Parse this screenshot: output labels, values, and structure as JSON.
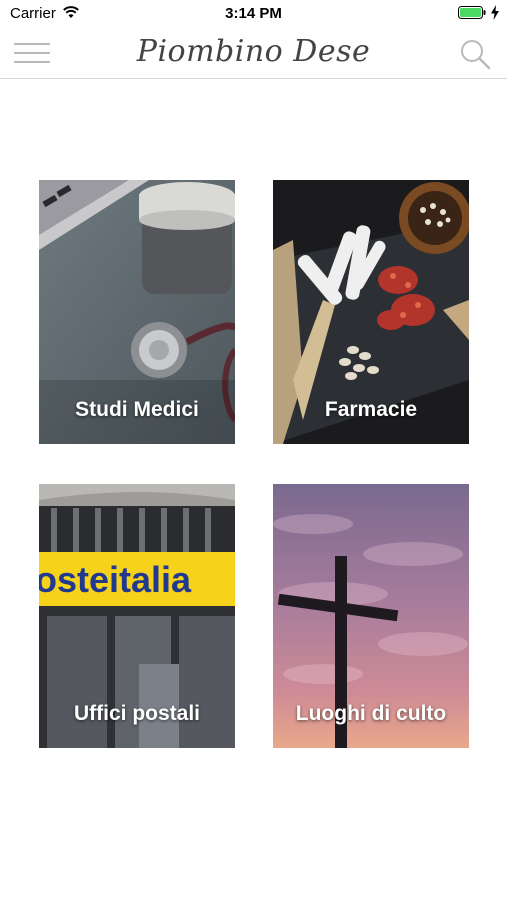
{
  "status_bar": {
    "carrier": "Carrier",
    "time": "3:14 PM"
  },
  "nav": {
    "title": "Piombino Dese",
    "menu_icon": "hamburger-menu-icon",
    "search_icon": "search-icon"
  },
  "tiles": [
    {
      "label": "Studi Medici",
      "image": "stethoscope-photo"
    },
    {
      "label": "Farmacie",
      "image": "herbal-remedies-photo"
    },
    {
      "label": "Uffici postali",
      "image": "post-office-photo",
      "sign_text": "osteitalia"
    },
    {
      "label": "Luoghi di culto",
      "image": "cross-sunset-photo"
    }
  ],
  "colors": {
    "battery": "#4cd964",
    "nav_icon": "#b9b9b9",
    "title": "#444444"
  }
}
